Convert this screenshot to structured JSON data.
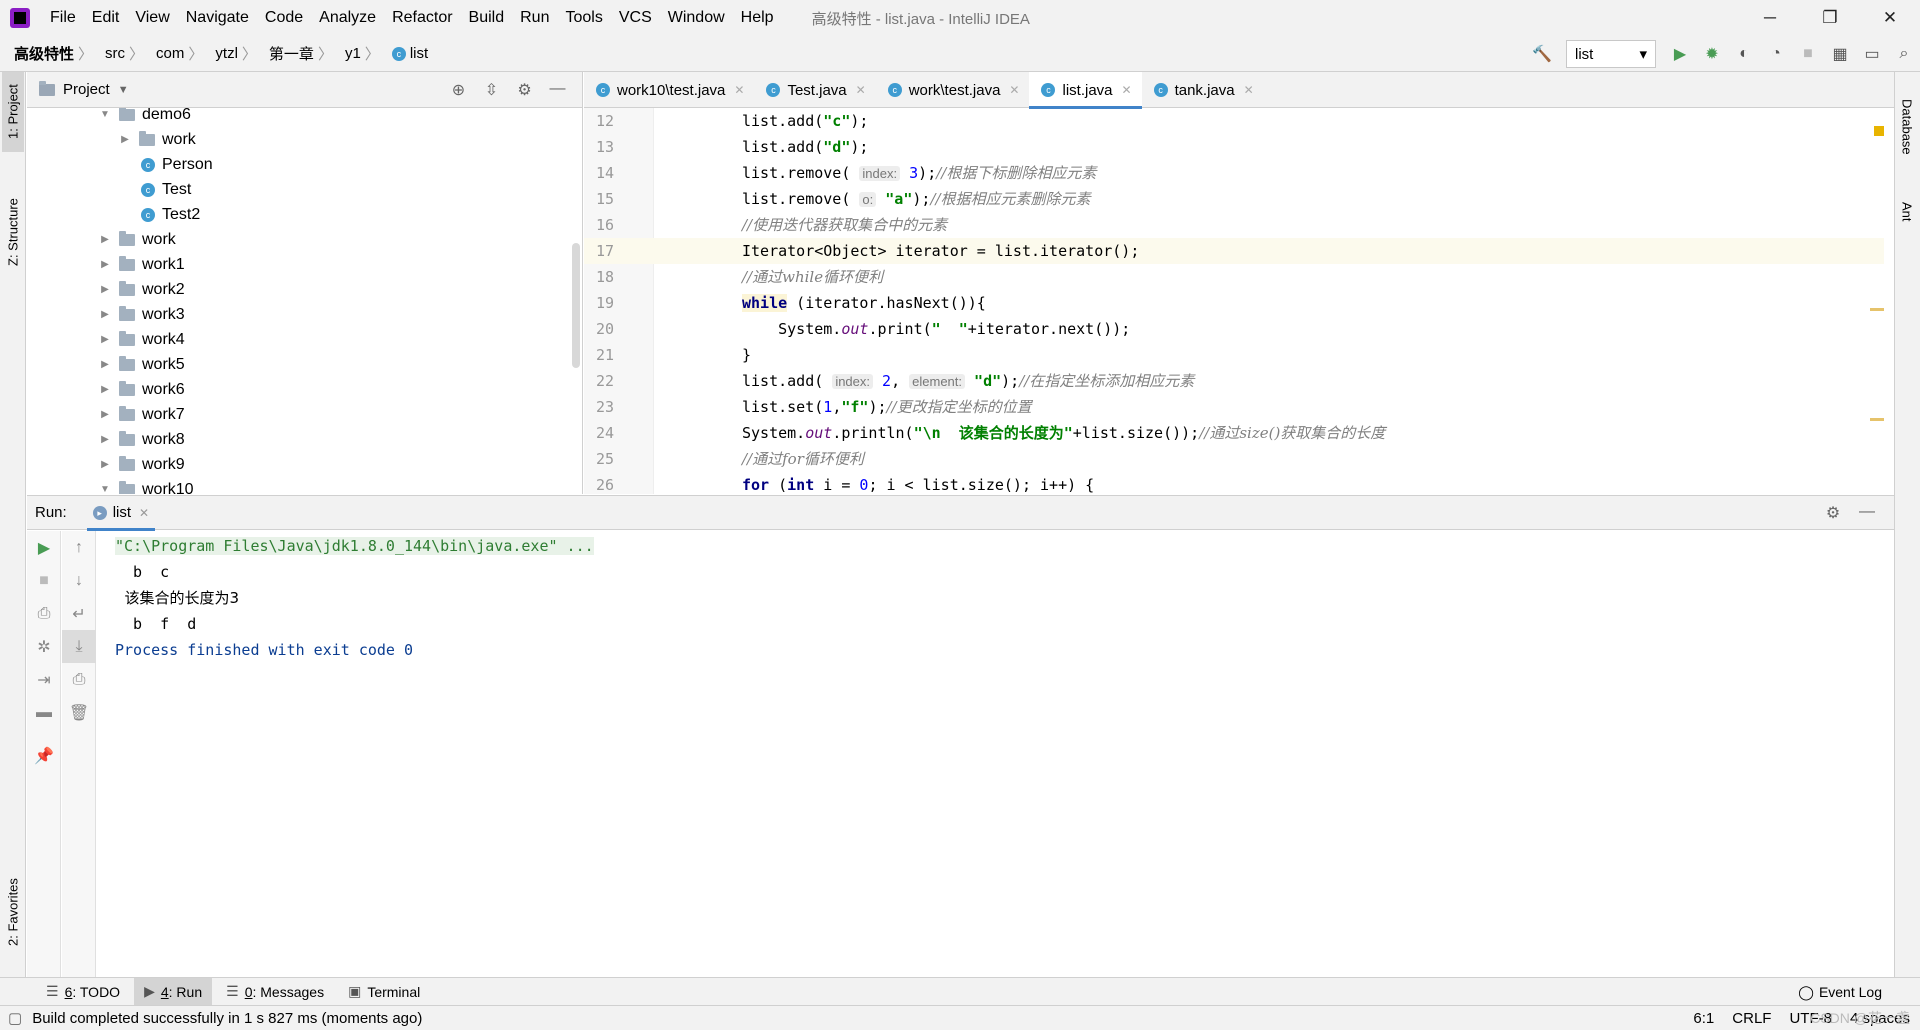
{
  "menubar": {
    "items": [
      "File",
      "Edit",
      "View",
      "Navigate",
      "Code",
      "Analyze",
      "Refactor",
      "Build",
      "Run",
      "Tools",
      "VCS",
      "Window",
      "Help"
    ],
    "window_title": "高级特性 - list.java - IntelliJ IDEA",
    "minimize": "─",
    "maximize": "❐",
    "close": "✕"
  },
  "breadcrumb": [
    "高级特性",
    "src",
    "com",
    "ytzl",
    "第一章",
    "y1",
    "list"
  ],
  "toolbar": {
    "run_config": "list"
  },
  "left_strip": {
    "project": "1: Project",
    "structure": "Z: Structure",
    "favorites": "2: Favorites"
  },
  "right_strip": {
    "database": "Database",
    "ant": "Ant"
  },
  "project_panel": {
    "title": "Project",
    "tree": [
      {
        "label": "demo6",
        "type": "folder",
        "depth": 0,
        "expanded": true
      },
      {
        "label": "work",
        "type": "folder",
        "depth": 1,
        "expanded": false
      },
      {
        "label": "Person",
        "type": "class",
        "depth": 1
      },
      {
        "label": "Test",
        "type": "class",
        "depth": 1
      },
      {
        "label": "Test2",
        "type": "class",
        "depth": 1
      },
      {
        "label": "work",
        "type": "folder",
        "depth": 0,
        "expanded": false
      },
      {
        "label": "work1",
        "type": "folder",
        "depth": 0,
        "expanded": false
      },
      {
        "label": "work2",
        "type": "folder",
        "depth": 0,
        "expanded": false
      },
      {
        "label": "work3",
        "type": "folder",
        "depth": 0,
        "expanded": false
      },
      {
        "label": "work4",
        "type": "folder",
        "depth": 0,
        "expanded": false
      },
      {
        "label": "work5",
        "type": "folder",
        "depth": 0,
        "expanded": false
      },
      {
        "label": "work6",
        "type": "folder",
        "depth": 0,
        "expanded": false
      },
      {
        "label": "work7",
        "type": "folder",
        "depth": 0,
        "expanded": false
      },
      {
        "label": "work8",
        "type": "folder",
        "depth": 0,
        "expanded": false
      },
      {
        "label": "work9",
        "type": "folder",
        "depth": 0,
        "expanded": false
      },
      {
        "label": "work10",
        "type": "folder",
        "depth": 0,
        "expanded": true
      }
    ]
  },
  "editor": {
    "tabs": [
      {
        "label": "work10\\test.java",
        "active": false
      },
      {
        "label": "Test.java",
        "active": false
      },
      {
        "label": "work\\test.java",
        "active": false
      },
      {
        "label": "list.java",
        "active": true
      },
      {
        "label": "tank.java",
        "active": false
      }
    ],
    "lines": [
      "12",
      "13",
      "14",
      "15",
      "16",
      "17",
      "18",
      "19",
      "20",
      "21",
      "22",
      "23",
      "24",
      "25",
      "26"
    ]
  },
  "run_panel": {
    "label": "Run:",
    "tab": "list",
    "console": [
      "\"C:\\Program Files\\Java\\jdk1.8.0_144\\bin\\java.exe\" ...",
      "  b  c",
      "  该集合的长度为3",
      "  b  f  d",
      "Process finished with exit code 0"
    ]
  },
  "bottom_tabs": [
    {
      "num": "6",
      "label": ": TODO",
      "active": false
    },
    {
      "num": "4",
      "label": ": Run",
      "active": true
    },
    {
      "num": "0",
      "label": ": Messages",
      "active": false
    },
    {
      "num": "",
      "label": "Terminal",
      "active": false
    }
  ],
  "event_log": "Event Log",
  "status": {
    "message": "Build completed successfully in 1 s 827 ms (moments ago)",
    "position": "6:1",
    "line_sep": "CRLF",
    "encoding": "UTF-8",
    "indent": "4 spaces",
    "watermark": "CSDN @花一盏"
  }
}
